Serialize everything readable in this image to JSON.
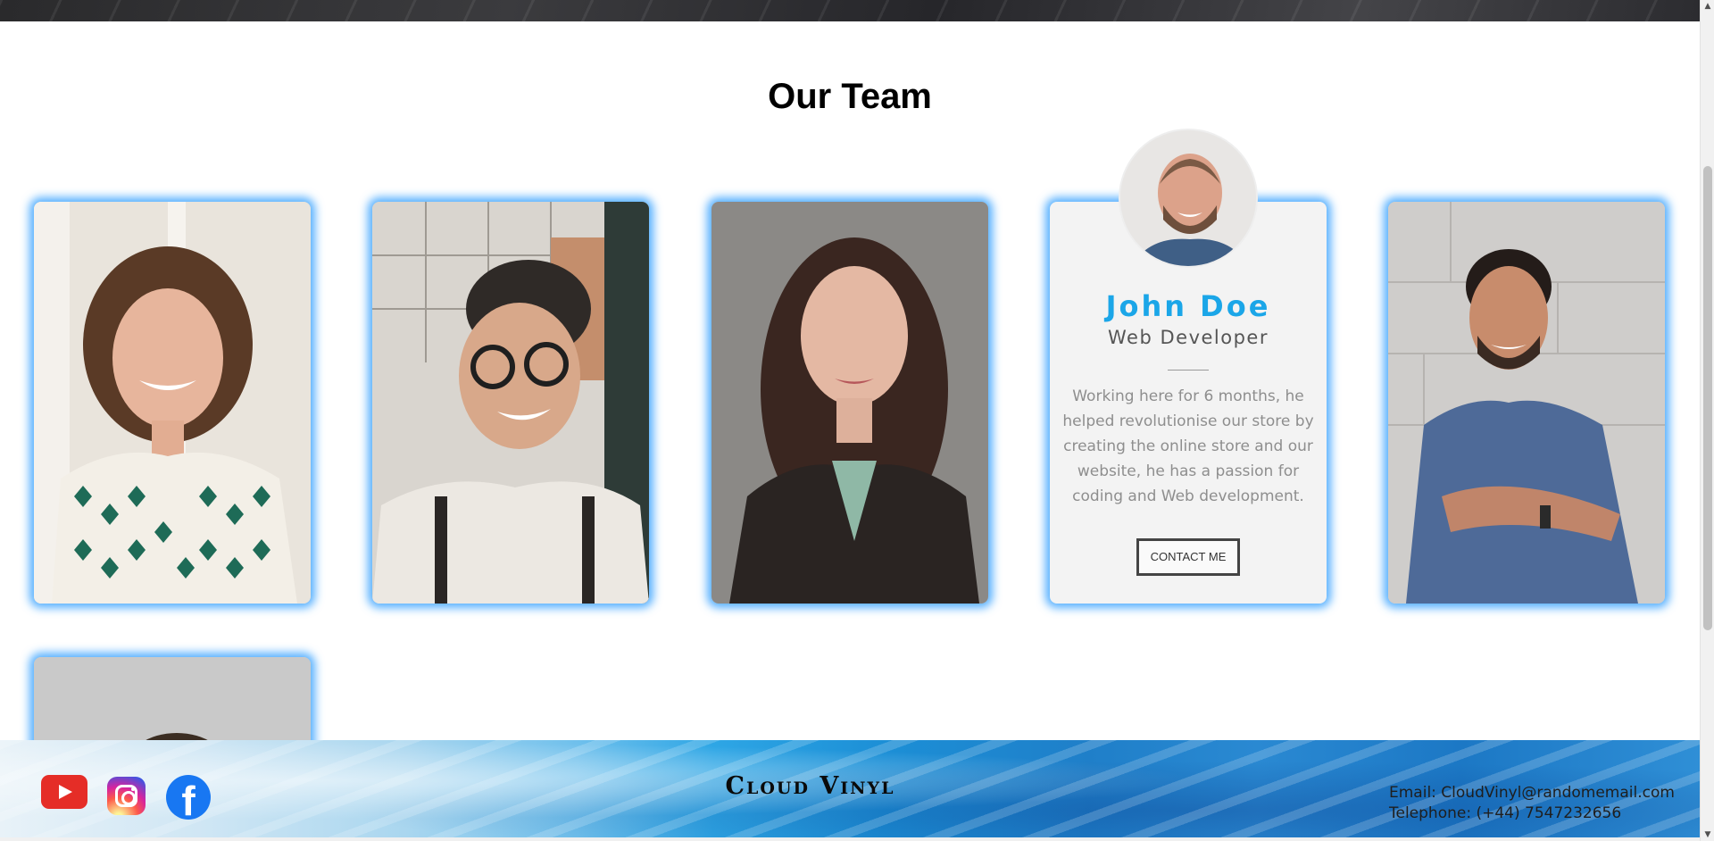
{
  "section": {
    "title": "Our Team"
  },
  "team": {
    "cards": [
      {
        "name": "team-card-1",
        "photo": "woman-curly-hair-smiling"
      },
      {
        "name": "team-card-2",
        "photo": "man-glasses-smiling"
      },
      {
        "name": "team-card-3",
        "photo": "woman-dark-hair-blazer"
      },
      {
        "name": "team-card-4",
        "photo": "john-doe"
      },
      {
        "name": "team-card-5",
        "photo": "man-blue-tshirt-arms-crossed"
      },
      {
        "name": "team-card-6",
        "photo": "partial-photo"
      }
    ],
    "active": {
      "name": "John Doe",
      "role": "Web Developer",
      "description": "Working here for 6 months, he helped revolutionise our store by creating the online store and our website, he has a passion for coding and Web development.",
      "contact_label": "CONTACT ME"
    }
  },
  "footer": {
    "brand": "Cloud Vinyl",
    "email": "Email: CloudVinyl@randomemail.com",
    "telephone": "Telephone: (+44) 7547232656",
    "social": [
      "youtube-icon",
      "instagram-icon",
      "facebook-icon"
    ],
    "facebook_glyph": "f"
  },
  "colors": {
    "accent": "#1ba6e8",
    "card_glow": "#1e96ff",
    "footer_blue": "#1c8fd6"
  }
}
